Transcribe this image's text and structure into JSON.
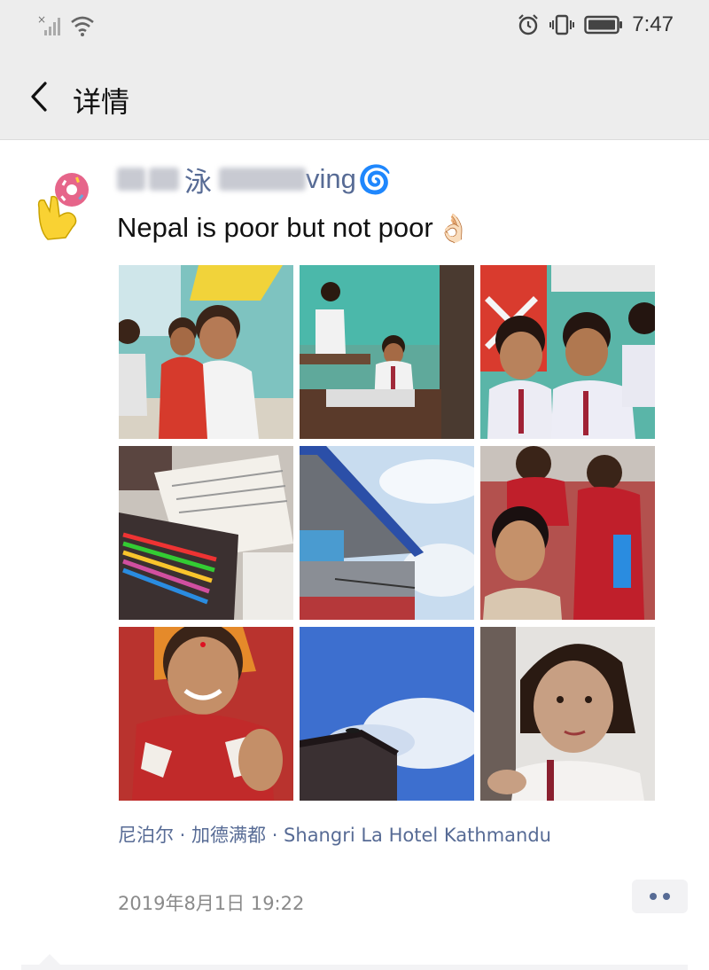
{
  "status_bar": {
    "time": "7:47",
    "icons": [
      "signal-off-icon",
      "wifi-icon",
      "alarm-icon",
      "vibrate-icon",
      "battery-icon"
    ]
  },
  "nav": {
    "back_icon": "chevron-left-icon",
    "title": "详情"
  },
  "post": {
    "author": {
      "name_visible_fragment_1": "泳",
      "name_visible_fragment_2": "ving",
      "emoji": "🌀",
      "avatar_icon": "hand-holding-donut-icon"
    },
    "text": "Nepal is poor but not poor",
    "text_emoji": "👌🏻",
    "photos": [
      {
        "name": "photo-classroom-girl"
      },
      {
        "name": "photo-classroom-boy"
      },
      {
        "name": "photo-boys-peace-sign"
      },
      {
        "name": "photo-pencil-case"
      },
      {
        "name": "photo-building-sky"
      },
      {
        "name": "photo-boy-festival"
      },
      {
        "name": "photo-smiling-girl"
      },
      {
        "name": "photo-blue-sky-roof"
      },
      {
        "name": "photo-girl-braids"
      }
    ],
    "location": "尼泊尔 · 加德满都 · Shangri La Hotel Kathmandu",
    "timestamp": "2019年8月1日 19:22"
  },
  "colors": {
    "link": "#576b95",
    "bar_bg": "#ededed",
    "meta_gray": "#8a8a8a"
  }
}
